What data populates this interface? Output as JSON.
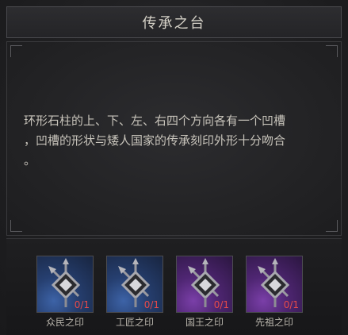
{
  "header": {
    "title": "传承之台"
  },
  "panel": {
    "description": "环形石柱的上、下、左、右四个方向各有一个凹槽\n，凹槽的形状与矮人国家的传承刻印外形十分吻合\n。"
  },
  "slots": [
    {
      "label": "众民之印",
      "count": "0/1",
      "rarity": "blue",
      "icon": "seal-icon"
    },
    {
      "label": "工匠之印",
      "count": "0/1",
      "rarity": "blue",
      "icon": "seal-icon"
    },
    {
      "label": "国王之印",
      "count": "0/1",
      "rarity": "purple",
      "icon": "seal-icon"
    },
    {
      "label": "先祖之印",
      "count": "0/1",
      "rarity": "purple",
      "icon": "seal-icon"
    }
  ],
  "colors": {
    "count_text": "#e64a4a",
    "blue_slot": "#263f70",
    "purple_slot": "#4f2673"
  }
}
